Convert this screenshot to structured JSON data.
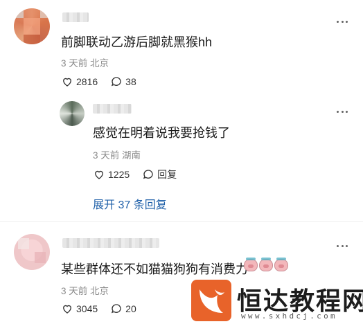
{
  "comments": [
    {
      "text": "前脚联动乙游后脚就黑猴hh",
      "meta": "3 天前 北京",
      "likes": "2816",
      "replies": "38"
    },
    {
      "text": "感觉在明着说我要抢钱了",
      "meta": "3 天前 湖南",
      "likes": "1225",
      "reply_label": "回复"
    },
    {
      "text": "某些群体还不如猫猫狗狗有消费力",
      "meta": "3 天前 北京",
      "likes": "3045",
      "replies": "20"
    }
  ],
  "expand_label": "展开 37 条回复",
  "watermark": {
    "title": "恒达教程网",
    "url": "www.sxhdcj.com"
  },
  "colors": {
    "link": "#1e5fa8",
    "meta": "#8a8a8a",
    "brand": "#e8632a"
  }
}
